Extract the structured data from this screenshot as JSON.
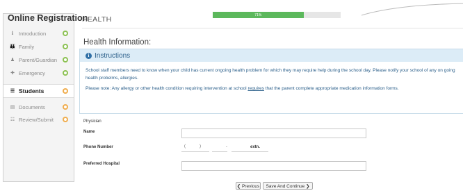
{
  "sidebar": {
    "title": "Online Registration",
    "items": [
      {
        "icon": "info-icon",
        "label": "Introduction",
        "status": "done"
      },
      {
        "icon": "family-icon",
        "label": "Family",
        "status": "done"
      },
      {
        "icon": "person-icon",
        "label": "Parent/Guardian",
        "status": "done"
      },
      {
        "icon": "emergency-icon",
        "label": "Emergency",
        "status": "done"
      },
      {
        "icon": "list-icon",
        "label": "Students",
        "status": "pending",
        "active": true
      },
      {
        "icon": "document-icon",
        "label": "Documents",
        "status": "pending"
      },
      {
        "icon": "checklist-icon",
        "label": "Review/Submit",
        "status": "pending"
      }
    ]
  },
  "header": {
    "section": "HEALTH",
    "progress_label": "71%",
    "progress_value": 0.71,
    "progress_color": "#5cb85c"
  },
  "content": {
    "title": "Health Information:",
    "instructions": {
      "heading": "Instructions",
      "p1": "School staff members need to know when your child has current ongoing health problem for which they may require help during the school day. Please notify your school of any on going health probelms, allergies.",
      "p2a": "Please note: Any allergy or other health condition requiring intervention at school ",
      "p2_link": "requires",
      "p2b": " that the parent complete appropriate medication information forms."
    },
    "physician_label": "Physician",
    "name_label": "Name",
    "phone_label": "Phone Number",
    "phone_open": "(",
    "phone_close": ")",
    "phone_dash": "-",
    "ext_label": "extn.",
    "hospital_label": "Preferred Hospital"
  },
  "buttons": {
    "previous": "❮ Previous",
    "save_continue": "Save And Continue ❯"
  },
  "colors": {
    "done": "#8cc152",
    "pending": "#f0ad4e",
    "instructions_header": "#dcecf7",
    "instructions_text": "#2b5f8a"
  }
}
